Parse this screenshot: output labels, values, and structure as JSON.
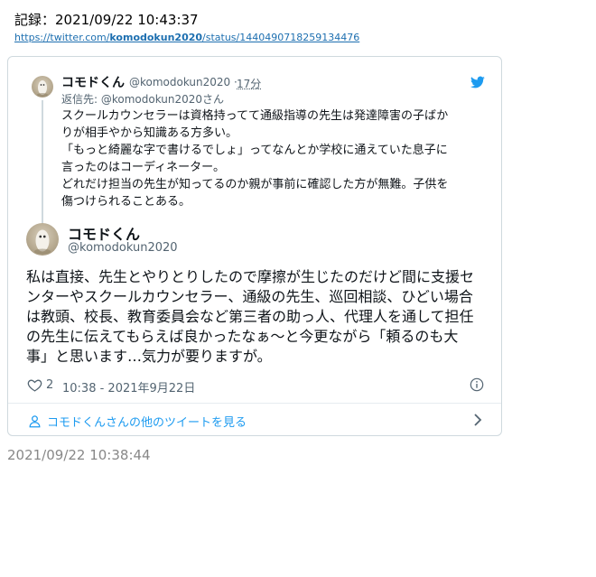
{
  "record": {
    "label": "記録：2021/09/22 10:43:37",
    "url_prefix": "https://twitter.com/",
    "url_user": "komodokun2020",
    "url_suffix": "/status/1440490718259134476"
  },
  "parent_tweet": {
    "name": "コモドくん",
    "handle": "@komodokun2020",
    "separator": "·",
    "time_ago": "17分",
    "reply_to": "返信先: @komodokun2020さん",
    "lines": [
      "スクールカウンセラーは資格持ってて通級指導の先生は発達障害の子ばか",
      "りが相手やから知識ある方多い。",
      "「もっと綺麗な字で書けるでしょ」ってなんとか学校に通えていた息子に",
      "言ったのはコーディネーター。",
      "どれだけ担当の先生が知ってるのか親が事前に確認した方が無難。子供を",
      "傷つけられることある。"
    ]
  },
  "main_tweet": {
    "name": "コモドくん",
    "handle": "@komodokun2020",
    "lines": [
      "私は直接、先生とやりとりしたので摩擦が生じたのだけど間に支援セ",
      "ンターやスクールカウンセラー、通級の先生、巡回相談、ひどい場合",
      "は教頭、校長、教育委員会など第三者の助っ人、代理人を通して担任",
      "の先生に伝えてもらえば良かったなぁ〜と今更ながら「頼るのも大",
      "事」と思います…気力が要りますが。"
    ],
    "likes": "2",
    "timestamp": "10:38 - 2021年9月22日"
  },
  "more_link": "コモドくんさんの他のツイートを見る",
  "footer_time": "2021/09/22 10:38:44",
  "icons": {
    "bird": "twitter-bird-icon",
    "heart": "heart-icon",
    "info": "info-icon",
    "person": "person-icon",
    "chevron": "chevron-right-icon"
  },
  "colors": {
    "twitter_blue": "#1d9bf0",
    "link": "#1d6fb0",
    "text": "#0f1419",
    "muted": "#536471",
    "border": "#cfd9de"
  }
}
